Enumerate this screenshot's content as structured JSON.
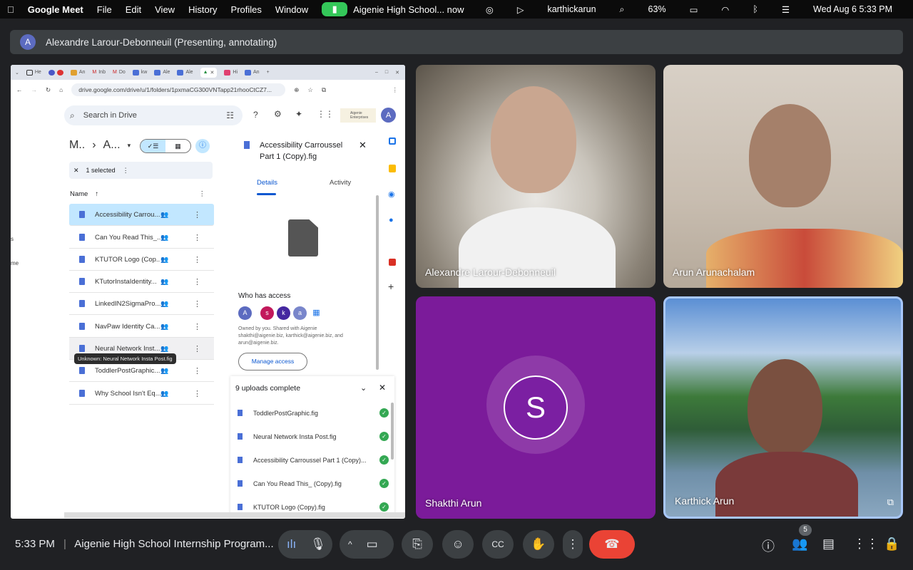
{
  "menubar": {
    "app": "Google Meet",
    "items": [
      "File",
      "Edit",
      "View",
      "History",
      "Profiles",
      "Window"
    ],
    "meeting_status": "Aigenie High School... now",
    "user": "karthickarun",
    "battery": "63%",
    "datetime": "Wed Aug 6 5:33 PM"
  },
  "banner": {
    "avatar": "A",
    "text": "Alexandre Larour-Debonneuil (Presenting, annotating)"
  },
  "browser": {
    "tabs": [
      "He",
      "",
      "An",
      "Inb",
      "Do",
      "kw",
      "Ale",
      "Ale",
      "",
      "Hi",
      "An"
    ],
    "url": "drive.google.com/drive/u/1/folders/1pxmaCG300VNTapp21rhooCtCZ7..."
  },
  "drive": {
    "search_placeholder": "Search in Drive",
    "org_logo": "Aigenie Enterprises",
    "account_avatar": "A",
    "breadcrumb": [
      "M..",
      "A..."
    ],
    "selection": "1 selected",
    "column_name": "Name",
    "files": [
      "Accessibility Carrou...",
      "Can You Read This_...",
      "KTUTOR Logo (Cop...",
      "KTutorInstaIdentity...",
      "LinkedIN2SigmaPro...",
      "NavPaw Identity Ca...",
      "Neural Network Inst...",
      "ToddlerPostGraphic...",
      "Why School Isn't Eq..."
    ],
    "tooltip": "Unknown: Neural Network Insta Post.fig",
    "details": {
      "title": "Accessibility Carroussel Part 1 (Copy).fig",
      "tabs": [
        "Details",
        "Activity"
      ],
      "access_heading": "Who has access",
      "access_avatars": [
        "A",
        "s",
        "k",
        "a"
      ],
      "access_text": "Owned by you. Shared with Aigenie shakthi@aigenie.biz, karthick@aigenie.biz, and arun@aigenie.biz.",
      "manage_access": "Manage access"
    },
    "uploads": {
      "title": "9 uploads complete",
      "items": [
        "ToddlerPostGraphic.fig",
        "Neural Network Insta Post.fig",
        "Accessibility Carroussel Part 1 (Copy)...",
        "Can You Read This_ (Copy).fig",
        "KTUTOR Logo (Copy).fig"
      ]
    },
    "left_edge": [
      "s",
      "me"
    ]
  },
  "participants": [
    {
      "name": "Alexandre Larour-Debonneuil"
    },
    {
      "name": "Arun Arunachalam"
    },
    {
      "name": "Shakthi Arun",
      "initial": "S",
      "color": "#7b1fa2"
    },
    {
      "name": "Karthick Arun"
    }
  ],
  "bottombar": {
    "time": "5:33 PM",
    "meeting_title": "Aigenie High School Internship Program...",
    "participant_count": "5",
    "end_call_color": "#ea4335"
  }
}
